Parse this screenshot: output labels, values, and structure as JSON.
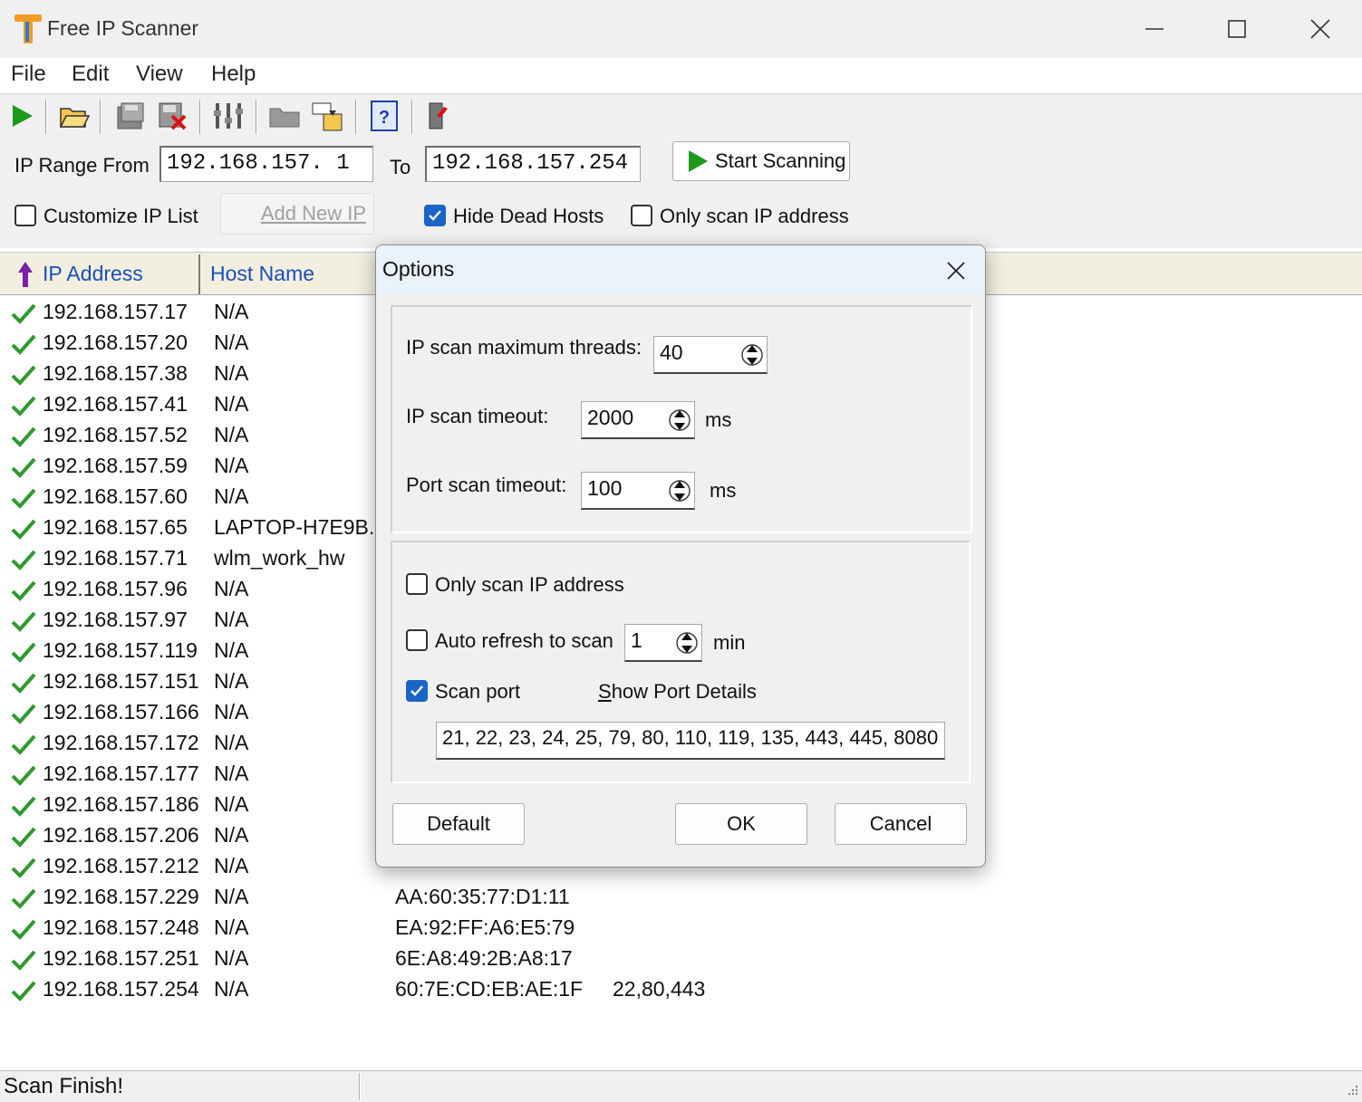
{
  "window": {
    "title": "Free IP Scanner",
    "minimize": "minimize",
    "maximize": "maximize",
    "close": "close"
  },
  "menu": [
    "File",
    "Edit",
    "View",
    "Help"
  ],
  "toolbar_icons": [
    "play-icon",
    "open-folder-icon",
    "save-icon",
    "delete-icon",
    "filter-icon",
    "folder-icon",
    "export-icon",
    "help-icon",
    "exit-icon"
  ],
  "range": {
    "from_label": "IP Range From",
    "from_value": "192.168.157. 1",
    "to_label": "To",
    "to_value": "192.168.157.254",
    "start_button": "Start Scanning"
  },
  "options_row": {
    "customize_label": "Customize IP List",
    "customize_checked": false,
    "add_new_ip": "Add New IP",
    "hide_dead_label": "Hide Dead Hosts",
    "hide_dead_checked": true,
    "only_scan_label": "Only scan IP address",
    "only_scan_checked": false
  },
  "table": {
    "headers": [
      "IP Address",
      "Host Name"
    ],
    "rows": [
      {
        "ip": "192.168.157.17",
        "host": "N/A",
        "mac": "",
        "ports": ""
      },
      {
        "ip": "192.168.157.20",
        "host": "N/A",
        "mac": "",
        "ports": ""
      },
      {
        "ip": "192.168.157.38",
        "host": "N/A",
        "mac": "",
        "ports": ""
      },
      {
        "ip": "192.168.157.41",
        "host": "N/A",
        "mac": "",
        "ports": ""
      },
      {
        "ip": "192.168.157.52",
        "host": "N/A",
        "mac": "",
        "ports": ""
      },
      {
        "ip": "192.168.157.59",
        "host": "N/A",
        "mac": "",
        "ports": ""
      },
      {
        "ip": "192.168.157.60",
        "host": "N/A",
        "mac": "",
        "ports": ""
      },
      {
        "ip": "192.168.157.65",
        "host": "LAPTOP-H7E9B...",
        "mac": "",
        "ports": ""
      },
      {
        "ip": "192.168.157.71",
        "host": "wlm_work_hw",
        "mac": "",
        "ports": ""
      },
      {
        "ip": "192.168.157.96",
        "host": "N/A",
        "mac": "",
        "ports": ""
      },
      {
        "ip": "192.168.157.97",
        "host": "N/A",
        "mac": "",
        "ports": ""
      },
      {
        "ip": "192.168.157.119",
        "host": "N/A",
        "mac": "",
        "ports": ""
      },
      {
        "ip": "192.168.157.151",
        "host": "N/A",
        "mac": "",
        "ports": ""
      },
      {
        "ip": "192.168.157.166",
        "host": "N/A",
        "mac": "",
        "ports": ""
      },
      {
        "ip": "192.168.157.172",
        "host": "N/A",
        "mac": "",
        "ports": ""
      },
      {
        "ip": "192.168.157.177",
        "host": "N/A",
        "mac": "",
        "ports": ""
      },
      {
        "ip": "192.168.157.186",
        "host": "N/A",
        "mac": "",
        "ports": ""
      },
      {
        "ip": "192.168.157.206",
        "host": "N/A",
        "mac": "",
        "ports": ""
      },
      {
        "ip": "192.168.157.212",
        "host": "N/A",
        "mac": "",
        "ports": ""
      },
      {
        "ip": "192.168.157.229",
        "host": "N/A",
        "mac": "AA:60:35:77:D1:11",
        "ports": ""
      },
      {
        "ip": "192.168.157.248",
        "host": "N/A",
        "mac": "EA:92:FF:A6:E5:79",
        "ports": ""
      },
      {
        "ip": "192.168.157.251",
        "host": "N/A",
        "mac": "6E:A8:49:2B:A8:17",
        "ports": ""
      },
      {
        "ip": "192.168.157.254",
        "host": "N/A",
        "mac": "60:7E:CD:EB:AE:1F",
        "ports": "22,80,443"
      }
    ]
  },
  "status": "Scan Finish!",
  "dialog": {
    "title": "Options",
    "max_threads_label": "IP scan maximum threads:",
    "max_threads_value": "40",
    "ip_timeout_label": "IP scan timeout:",
    "ip_timeout_value": "2000",
    "ip_timeout_unit": "ms",
    "port_timeout_label": "Port scan timeout:",
    "port_timeout_value": "100",
    "port_timeout_unit": "ms",
    "only_scan_label": "Only scan IP address",
    "only_scan_checked": false,
    "auto_refresh_label": "Auto refresh to scan",
    "auto_refresh_checked": false,
    "auto_refresh_value": "1",
    "auto_refresh_unit": "min",
    "scan_port_label": "Scan port",
    "scan_port_checked": true,
    "show_port_details": "Show Port Details",
    "ports_value": "21, 22, 23, 24, 25, 79, 80, 110, 119, 135, 443, 445, 8080",
    "default_button": "Default",
    "ok_button": "OK",
    "cancel_button": "Cancel"
  },
  "colors": {
    "header_link": "#1a4fb6",
    "checkbox_checked": "#1a64c8",
    "check_green": "#2e9a2e",
    "dialog_title_bg": "#eaf3fb"
  }
}
